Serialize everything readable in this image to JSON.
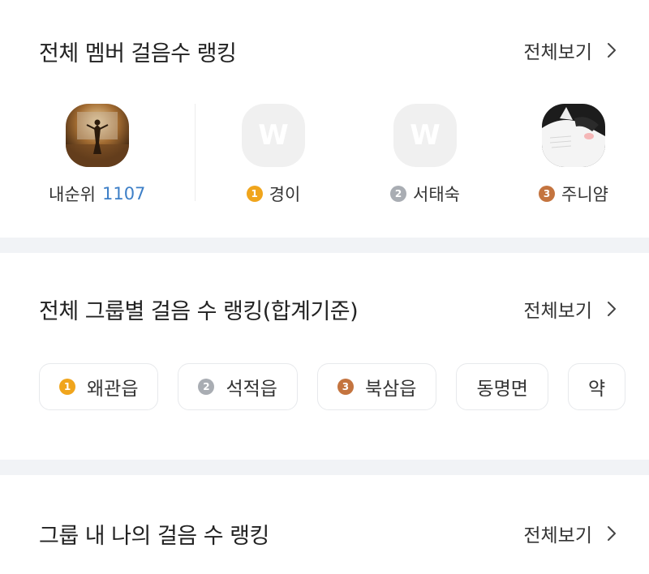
{
  "member_ranking": {
    "title": "전체 멤버 걸음수 랭킹",
    "see_all": "전체보기",
    "my_rank": {
      "label": "내순위",
      "value": "1107"
    },
    "top": [
      {
        "rank": "1",
        "name": "경이",
        "avatar": "w-logo",
        "medal_color": "#f0a51c"
      },
      {
        "rank": "2",
        "name": "서태숙",
        "avatar": "w-logo",
        "medal_color": "#a9adb3"
      },
      {
        "rank": "3",
        "name": "주니얌",
        "avatar": "cat-photo",
        "medal_color": "#c4743f"
      }
    ],
    "w_logo_letter": "W"
  },
  "group_ranking": {
    "title": "전체 그룹별 걸음 수 랭킹(합계기준)",
    "see_all": "전체보기",
    "chips": [
      {
        "rank": "1",
        "name": "왜관읍",
        "medal_color": "#f0a51c"
      },
      {
        "rank": "2",
        "name": "석적읍",
        "medal_color": "#a9adb3"
      },
      {
        "rank": "3",
        "name": "북삼읍",
        "medal_color": "#c4743f"
      },
      {
        "rank": "",
        "name": "동명면"
      },
      {
        "rank": "",
        "name": "약"
      }
    ]
  },
  "my_group_ranking": {
    "title": "그룹 내 나의 걸음 수 랭킹",
    "see_all": "전체보기"
  }
}
